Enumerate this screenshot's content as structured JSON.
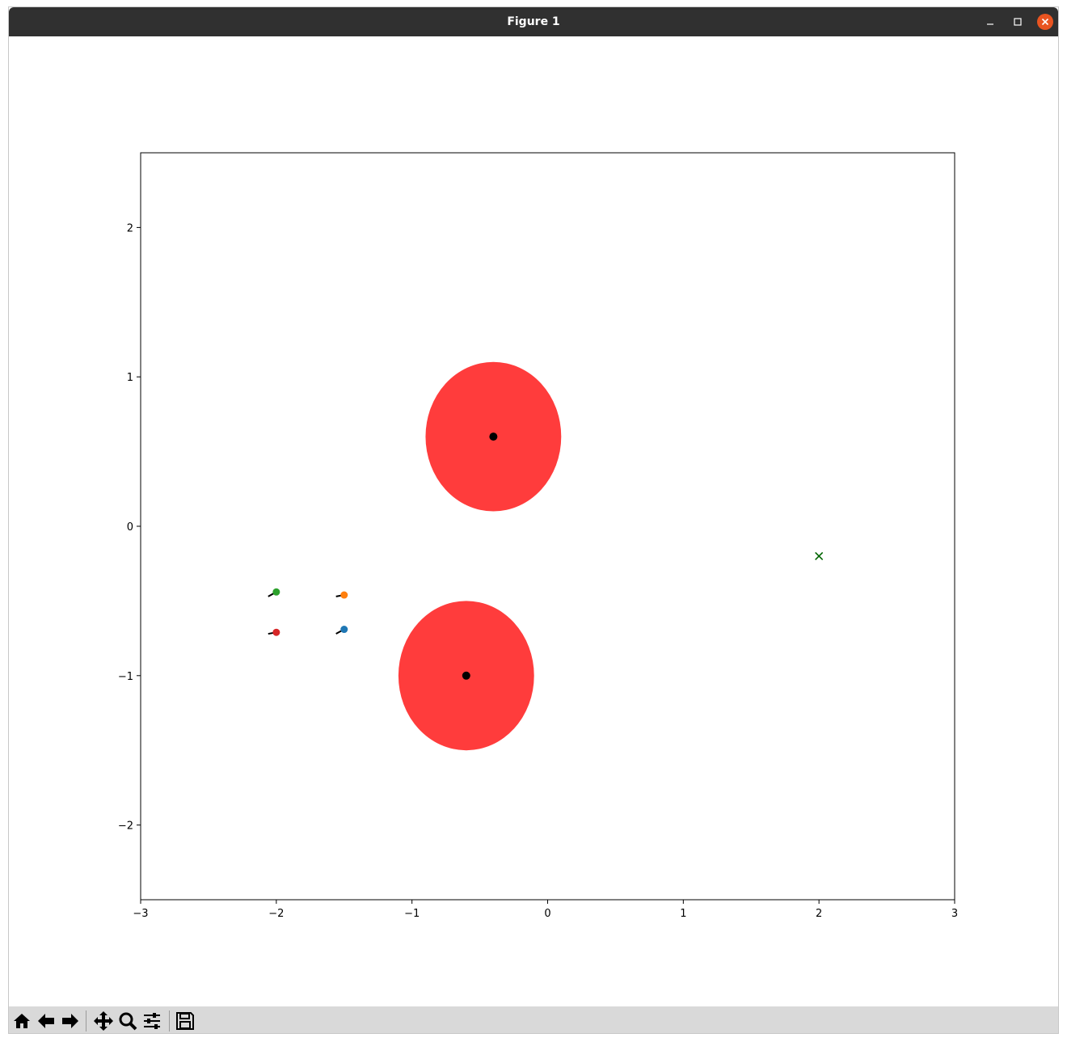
{
  "window": {
    "title": "Figure 1",
    "controls": [
      "minimize-icon",
      "maximize-icon",
      "close-icon"
    ],
    "close_color": "#e95420"
  },
  "toolbar": {
    "buttons": [
      "home-icon",
      "back-arrow-icon",
      "forward-arrow-icon",
      "pan-icon",
      "zoom-icon",
      "configure-subplots-icon",
      "save-icon"
    ]
  },
  "chart_data": {
    "type": "scatter",
    "xlim": [
      -3,
      3
    ],
    "ylim": [
      -2.5,
      2.5
    ],
    "xticks": [
      "−3",
      "−2",
      "−1",
      "0",
      "1",
      "2",
      "3"
    ],
    "yticks": [
      "−2",
      "−1",
      "0",
      "1",
      "2"
    ],
    "xtick_values": [
      -3,
      -2,
      -1,
      0,
      1,
      2,
      3
    ],
    "ytick_values": [
      -2,
      -1,
      0,
      1,
      2
    ],
    "grid": false,
    "obstacles": [
      {
        "x": -0.4,
        "y": 0.6,
        "radius": 0.5,
        "color": "#ff3c3c"
      },
      {
        "x": -0.6,
        "y": -1.0,
        "radius": 0.5,
        "color": "#ff3c3c"
      }
    ],
    "obstacle_centers_color": "#000000",
    "goal": {
      "x": 2.0,
      "y": -0.2,
      "marker": "x",
      "color": "#006400"
    },
    "agents": [
      {
        "x": -1.5,
        "y": -0.69,
        "color": "#1f77b4",
        "trail": [
          [
            -1.56,
            -0.72
          ],
          [
            -1.5,
            -0.69
          ]
        ]
      },
      {
        "x": -1.5,
        "y": -0.46,
        "color": "#ff7f0e",
        "trail": [
          [
            -1.56,
            -0.47
          ],
          [
            -1.5,
            -0.46
          ]
        ]
      },
      {
        "x": -2.0,
        "y": -0.44,
        "color": "#2ca02c",
        "trail": [
          [
            -2.06,
            -0.47
          ],
          [
            -2.0,
            -0.44
          ]
        ]
      },
      {
        "x": -2.0,
        "y": -0.71,
        "color": "#d62728",
        "trail": [
          [
            -2.06,
            -0.72
          ],
          [
            -2.0,
            -0.71
          ]
        ]
      }
    ]
  }
}
